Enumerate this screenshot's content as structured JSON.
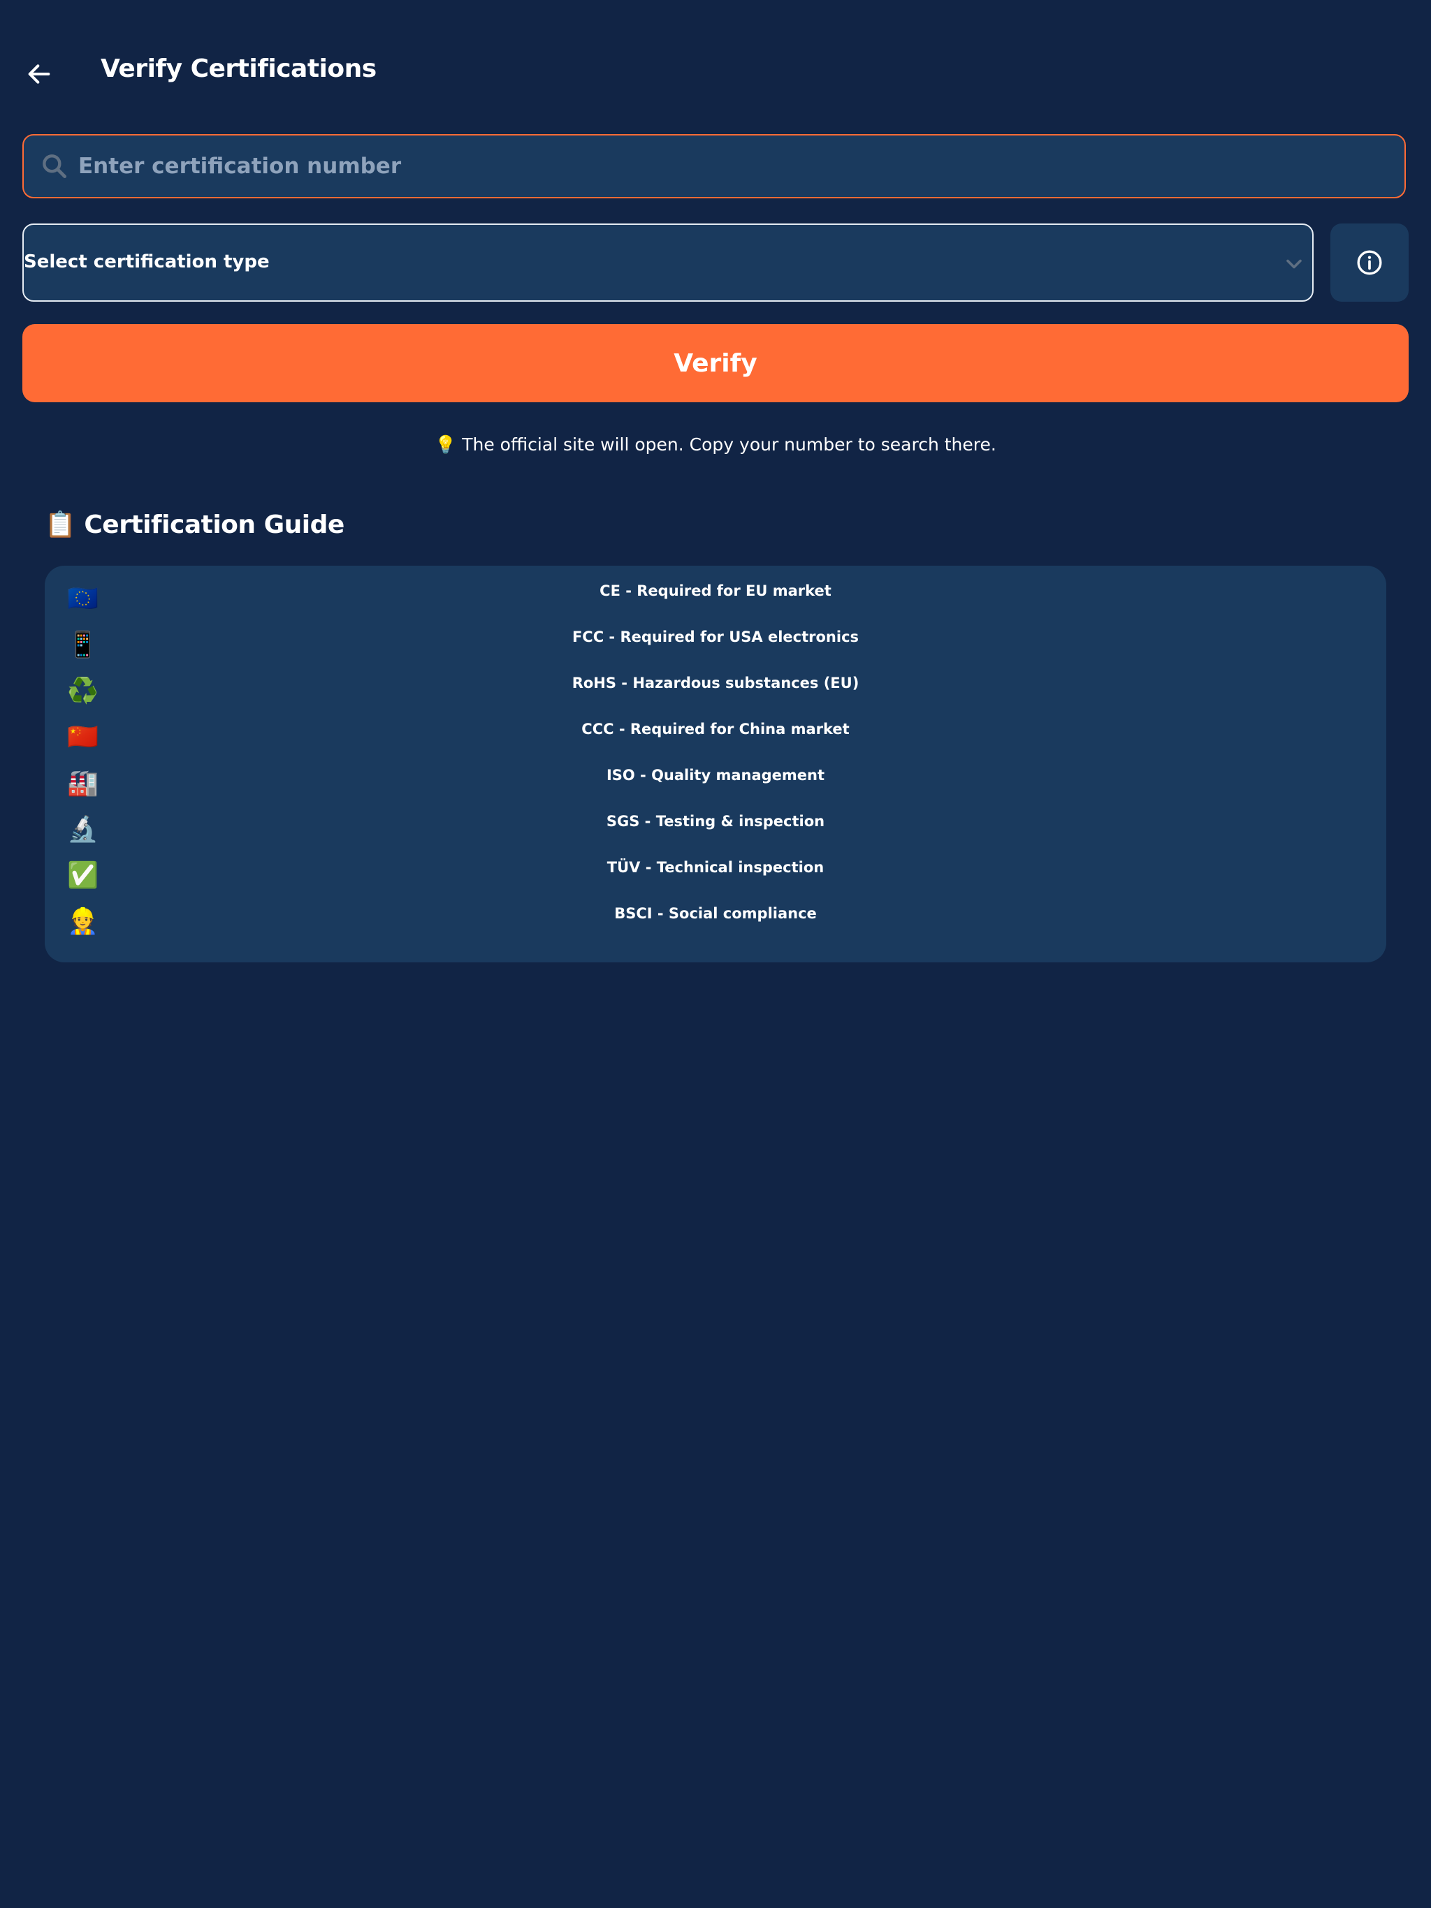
{
  "header": {
    "title": "Verify Certifications",
    "back_icon": "arrow-left-icon"
  },
  "search": {
    "placeholder": "Enter certification number",
    "value": "",
    "icon": "search-icon"
  },
  "select": {
    "label": "Select certification type",
    "icon": "chevron-down-icon"
  },
  "info_button": {
    "icon": "info-circle-icon"
  },
  "verify_button": {
    "label": "Verify"
  },
  "hint": {
    "text": "💡 The official site will open. Copy your number to search there."
  },
  "guide": {
    "title": "📋 Certification Guide",
    "items": [
      {
        "icon": "eu-flag-icon",
        "glyph": "🇪🇺",
        "text": "CE - Required for EU market"
      },
      {
        "icon": "mobile-phone-icon",
        "glyph": "📱",
        "text": "FCC - Required for USA electronics"
      },
      {
        "icon": "recycle-icon",
        "glyph": "♻️",
        "text": "RoHS - Hazardous substances (EU)"
      },
      {
        "icon": "china-flag-icon",
        "glyph": "🇨🇳",
        "text": "CCC - Required for China market"
      },
      {
        "icon": "factory-icon",
        "glyph": "🏭",
        "text": "ISO - Quality management"
      },
      {
        "icon": "microscope-icon",
        "glyph": "🔬",
        "text": "SGS - Testing & inspection"
      },
      {
        "icon": "check-mark-icon",
        "glyph": "✅",
        "text": "TÜV - Technical inspection"
      },
      {
        "icon": "construction-worker-icon",
        "glyph": "👷",
        "text": "BSCI - Social compliance"
      }
    ]
  },
  "colors": {
    "background": "#112445",
    "surface": "#1a3a5e",
    "accent": "#ff6b35",
    "text": "#ffffff",
    "placeholder": "#8fa3bc"
  }
}
